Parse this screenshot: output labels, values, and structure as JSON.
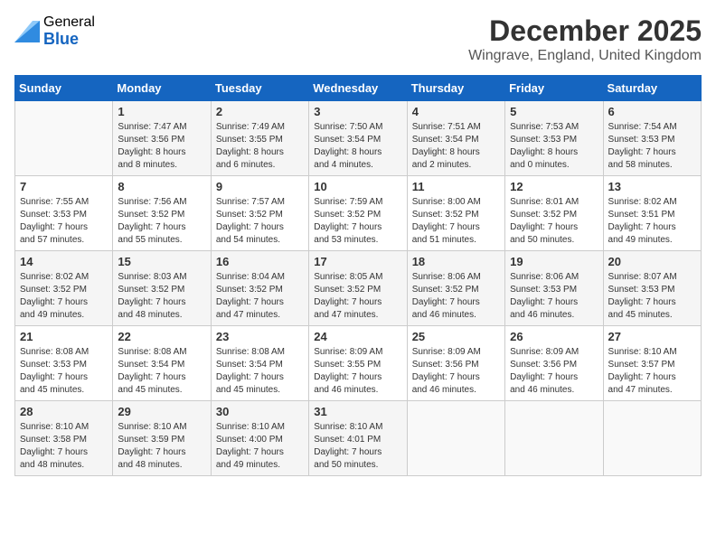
{
  "logo": {
    "general": "General",
    "blue": "Blue"
  },
  "title": {
    "month": "December 2025",
    "location": "Wingrave, England, United Kingdom"
  },
  "weekdays": [
    "Sunday",
    "Monday",
    "Tuesday",
    "Wednesday",
    "Thursday",
    "Friday",
    "Saturday"
  ],
  "weeks": [
    [
      {
        "day": "",
        "info": ""
      },
      {
        "day": "1",
        "info": "Sunrise: 7:47 AM\nSunset: 3:56 PM\nDaylight: 8 hours\nand 8 minutes."
      },
      {
        "day": "2",
        "info": "Sunrise: 7:49 AM\nSunset: 3:55 PM\nDaylight: 8 hours\nand 6 minutes."
      },
      {
        "day": "3",
        "info": "Sunrise: 7:50 AM\nSunset: 3:54 PM\nDaylight: 8 hours\nand 4 minutes."
      },
      {
        "day": "4",
        "info": "Sunrise: 7:51 AM\nSunset: 3:54 PM\nDaylight: 8 hours\nand 2 minutes."
      },
      {
        "day": "5",
        "info": "Sunrise: 7:53 AM\nSunset: 3:53 PM\nDaylight: 8 hours\nand 0 minutes."
      },
      {
        "day": "6",
        "info": "Sunrise: 7:54 AM\nSunset: 3:53 PM\nDaylight: 7 hours\nand 58 minutes."
      }
    ],
    [
      {
        "day": "7",
        "info": "Sunrise: 7:55 AM\nSunset: 3:53 PM\nDaylight: 7 hours\nand 57 minutes."
      },
      {
        "day": "8",
        "info": "Sunrise: 7:56 AM\nSunset: 3:52 PM\nDaylight: 7 hours\nand 55 minutes."
      },
      {
        "day": "9",
        "info": "Sunrise: 7:57 AM\nSunset: 3:52 PM\nDaylight: 7 hours\nand 54 minutes."
      },
      {
        "day": "10",
        "info": "Sunrise: 7:59 AM\nSunset: 3:52 PM\nDaylight: 7 hours\nand 53 minutes."
      },
      {
        "day": "11",
        "info": "Sunrise: 8:00 AM\nSunset: 3:52 PM\nDaylight: 7 hours\nand 51 minutes."
      },
      {
        "day": "12",
        "info": "Sunrise: 8:01 AM\nSunset: 3:52 PM\nDaylight: 7 hours\nand 50 minutes."
      },
      {
        "day": "13",
        "info": "Sunrise: 8:02 AM\nSunset: 3:51 PM\nDaylight: 7 hours\nand 49 minutes."
      }
    ],
    [
      {
        "day": "14",
        "info": "Sunrise: 8:02 AM\nSunset: 3:52 PM\nDaylight: 7 hours\nand 49 minutes."
      },
      {
        "day": "15",
        "info": "Sunrise: 8:03 AM\nSunset: 3:52 PM\nDaylight: 7 hours\nand 48 minutes."
      },
      {
        "day": "16",
        "info": "Sunrise: 8:04 AM\nSunset: 3:52 PM\nDaylight: 7 hours\nand 47 minutes."
      },
      {
        "day": "17",
        "info": "Sunrise: 8:05 AM\nSunset: 3:52 PM\nDaylight: 7 hours\nand 47 minutes."
      },
      {
        "day": "18",
        "info": "Sunrise: 8:06 AM\nSunset: 3:52 PM\nDaylight: 7 hours\nand 46 minutes."
      },
      {
        "day": "19",
        "info": "Sunrise: 8:06 AM\nSunset: 3:53 PM\nDaylight: 7 hours\nand 46 minutes."
      },
      {
        "day": "20",
        "info": "Sunrise: 8:07 AM\nSunset: 3:53 PM\nDaylight: 7 hours\nand 45 minutes."
      }
    ],
    [
      {
        "day": "21",
        "info": "Sunrise: 8:08 AM\nSunset: 3:53 PM\nDaylight: 7 hours\nand 45 minutes."
      },
      {
        "day": "22",
        "info": "Sunrise: 8:08 AM\nSunset: 3:54 PM\nDaylight: 7 hours\nand 45 minutes."
      },
      {
        "day": "23",
        "info": "Sunrise: 8:08 AM\nSunset: 3:54 PM\nDaylight: 7 hours\nand 45 minutes."
      },
      {
        "day": "24",
        "info": "Sunrise: 8:09 AM\nSunset: 3:55 PM\nDaylight: 7 hours\nand 46 minutes."
      },
      {
        "day": "25",
        "info": "Sunrise: 8:09 AM\nSunset: 3:56 PM\nDaylight: 7 hours\nand 46 minutes."
      },
      {
        "day": "26",
        "info": "Sunrise: 8:09 AM\nSunset: 3:56 PM\nDaylight: 7 hours\nand 46 minutes."
      },
      {
        "day": "27",
        "info": "Sunrise: 8:10 AM\nSunset: 3:57 PM\nDaylight: 7 hours\nand 47 minutes."
      }
    ],
    [
      {
        "day": "28",
        "info": "Sunrise: 8:10 AM\nSunset: 3:58 PM\nDaylight: 7 hours\nand 48 minutes."
      },
      {
        "day": "29",
        "info": "Sunrise: 8:10 AM\nSunset: 3:59 PM\nDaylight: 7 hours\nand 48 minutes."
      },
      {
        "day": "30",
        "info": "Sunrise: 8:10 AM\nSunset: 4:00 PM\nDaylight: 7 hours\nand 49 minutes."
      },
      {
        "day": "31",
        "info": "Sunrise: 8:10 AM\nSunset: 4:01 PM\nDaylight: 7 hours\nand 50 minutes."
      },
      {
        "day": "",
        "info": ""
      },
      {
        "day": "",
        "info": ""
      },
      {
        "day": "",
        "info": ""
      }
    ]
  ]
}
